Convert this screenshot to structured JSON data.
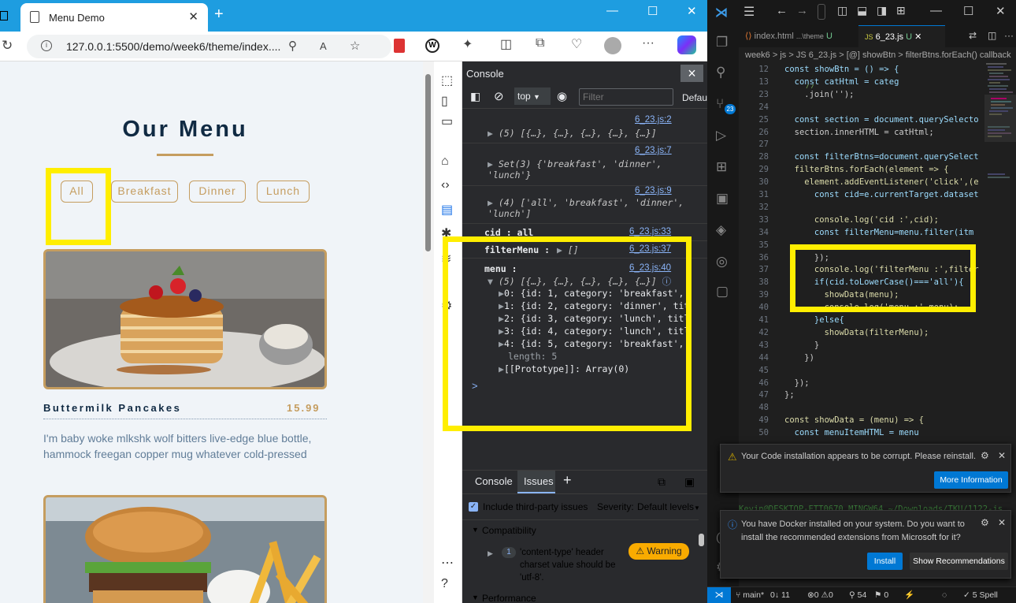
{
  "browser": {
    "tab_title": "Menu Demo",
    "url": "127.0.0.1:5500/demo/week6/theme/index....",
    "new_tab_symbol": "+",
    "controls": {
      "minimize": "—",
      "maximize": "☐",
      "close": "✕"
    }
  },
  "page": {
    "title": "Our Menu",
    "filters": [
      "All",
      "Breakfast",
      "Dinner",
      "Lunch"
    ],
    "item1": {
      "name": "Buttermilk Pancakes",
      "price": "15.99",
      "desc": "I'm baby woke mlkshk wolf bitters live-edge blue bottle, hammock freegan copper mug whatever cold-pressed"
    }
  },
  "devtools": {
    "panel_title": "Console",
    "context": "top",
    "filter_placeholder": "Filter",
    "levels": "Default levels",
    "logs": [
      {
        "src": "6_23.js:2",
        "text": "(5) [{…}, {…}, {…}, {…}, {…}]"
      },
      {
        "src": "6_23.js:7",
        "text": "Set(3) {'breakfast', 'dinner', 'lunch'}"
      },
      {
        "src": "6_23.js:9",
        "text": "(4) ['all', 'breakfast', 'dinner', 'lunch']"
      },
      {
        "src": "6_23.js:33",
        "label": "cid : all"
      },
      {
        "src": "6_23.js:37",
        "label": "filterMenu :",
        "text": "[]"
      },
      {
        "src": "6_23.js:40",
        "label": "menu :",
        "text": "(5) [{…}, {…}, {…}, {…}, {…}]"
      }
    ],
    "menu_entries": [
      "0: {id: 1, category: 'breakfast',",
      "1: {id: 2, category: 'dinner', tit",
      "2: {id: 3, category: 'lunch', titl",
      "3: {id: 4, category: 'lunch', titl",
      "4: {id: 5, category: 'breakfast',"
    ],
    "length_line": "length: 5",
    "prototype_line": "[[Prototype]]: Array(0)",
    "prompt": ">",
    "drawer": {
      "tabs": [
        "Console",
        "Issues"
      ],
      "add": "+",
      "include_third_party": "Include third-party issues",
      "severity_label": "Severity:",
      "severity_value": "Default levels",
      "section_compat": "Compatibility",
      "issue_count": "1",
      "issue_text": "'content-type' header charset value should be 'utf-8'.",
      "warning_badge": "Warning",
      "section_perf": "Performance"
    }
  },
  "vscode": {
    "tabs": [
      {
        "label": "index.html",
        "path": "...\\theme",
        "status": "U"
      },
      {
        "label": "6_23.js",
        "status": "U"
      }
    ],
    "breadcrumb": "week6 > js > JS 6_23.js > [@] showBtn > filterBtns.forEach() callback",
    "line_numbers": [
      "12",
      "13",
      "23",
      "24",
      "25",
      "26",
      "27",
      "28",
      "29",
      "30",
      "31",
      "32",
      "33",
      "34",
      "35",
      "36",
      "37",
      "38",
      "39",
      "40",
      "41",
      "42",
      "43",
      "44",
      "45",
      "46",
      "47",
      "48",
      "49",
      "50"
    ],
    "code": [
      "const showBtn = () => {",
      "  const catHtml = categ",
      "    //",
      "    .join('');",
      "",
      "  const section = document.querySelecto",
      "  section.innerHTML = catHtml;",
      "",
      "  const filterBtns=document.querySelect",
      "  filterBtns.forEach(element => {",
      "    element.addEventListener('click',(e",
      "      const cid=e.currentTarget.dataset",
      "",
      "      console.log('cid :',cid);",
      "      const filterMenu=menu.filter(itm",
      "",
      "      });",
      "      console.log('filterMenu :',filter",
      "      if(cid.toLowerCase()==='all'){",
      "        showData(menu);",
      "        console.log('menu :',menu);",
      "      }else{",
      "        showData(filterMenu);",
      "      }",
      "    })",
      "",
      "  });",
      "};",
      "",
      "const showData = (menu) => {",
      "  const menuItemHTML = menu"
    ],
    "terminal_text": "Kevin@DESKTOP-ETT0670 MINGW64 ~/Downloads/TKU/1122-js",
    "notif1": {
      "text": "Your Code installation appears to be corrupt. Please reinstall.",
      "button": "More Information"
    },
    "notif2": {
      "text": "You have Docker installed on your system. Do you want to install the recommended extensions from Microsoft for it?",
      "btn_install": "Install",
      "btn_recs": "Show Recommendations"
    },
    "status": {
      "branch": "main*",
      "sync": "0↓ 11",
      "problems": "⊗0 ⚠0",
      "ports": "54",
      "signals": "0",
      "spell": "5 Spell"
    },
    "scm_badge": "23"
  }
}
